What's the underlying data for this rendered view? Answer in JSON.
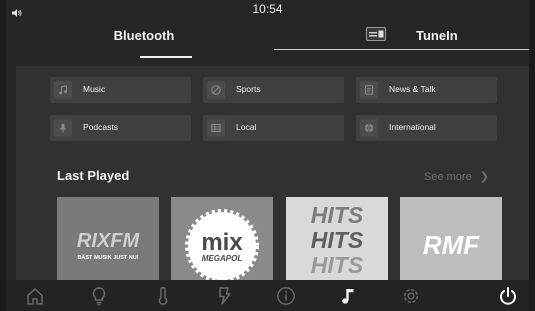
{
  "status": {
    "time": "10:54",
    "volume_icon": "speaker-icon"
  },
  "tabs": [
    {
      "label": "Bluetooth",
      "active": true
    },
    {
      "label": "TuneIn",
      "active": false,
      "icon": "radio-icon"
    }
  ],
  "categories": [
    {
      "label": "Music",
      "icon": "music-note-icon"
    },
    {
      "label": "Sports",
      "icon": "ball-icon"
    },
    {
      "label": "News & Talk",
      "icon": "document-icon"
    },
    {
      "label": "Podcasts",
      "icon": "microphone-icon"
    },
    {
      "label": "Local",
      "icon": "local-grid-icon"
    },
    {
      "label": "International",
      "icon": "globe-icon"
    }
  ],
  "last_played": {
    "title": "Last Played",
    "see_more": "See more",
    "stations": [
      {
        "name": "RIX FM",
        "logo_text": "RIXFM",
        "tagline": "BÄST MUSIK JUST NU!"
      },
      {
        "name": "MIX Megapol",
        "logo_text": "mix",
        "tagline": "MEGAPOL"
      },
      {
        "name": "HITS",
        "logo_text": "HITS"
      },
      {
        "name": "RMF",
        "logo_text": "RMF"
      }
    ]
  },
  "dock": [
    {
      "icon": "home-icon",
      "active": false
    },
    {
      "icon": "lightbulb-icon",
      "active": false
    },
    {
      "icon": "thermometer-icon",
      "active": false
    },
    {
      "icon": "charging-icon",
      "active": false
    },
    {
      "icon": "info-icon",
      "active": false
    },
    {
      "icon": "music-note-icon",
      "active": true
    },
    {
      "icon": "settings-icon",
      "active": false
    },
    {
      "icon": "power-icon",
      "active": false
    }
  ],
  "colors": {
    "background": "#262626",
    "panel": "#313131",
    "tile": "#404040",
    "text": "#f2f2f2",
    "muted": "#6e6e6e"
  }
}
